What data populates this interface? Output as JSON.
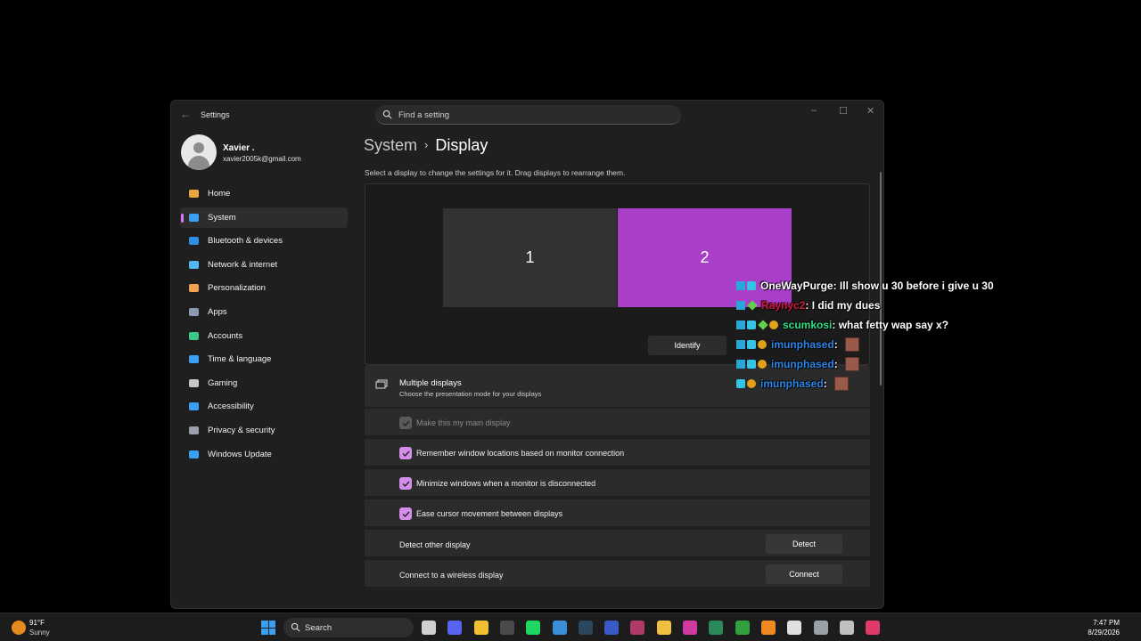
{
  "window": {
    "app_title": "Settings",
    "search_placeholder": "Find a setting",
    "controls": {
      "minimize": "–",
      "maximize": "☐",
      "close": "✕"
    },
    "back": "←"
  },
  "user": {
    "name": "Xavier .",
    "email": "xavier2005k@gmail.com"
  },
  "sidebar": {
    "items": [
      {
        "label": "Home",
        "icon": "home-icon",
        "color": "#e8a640"
      },
      {
        "label": "System",
        "icon": "system-icon",
        "color": "#3aa0f3",
        "active": true
      },
      {
        "label": "Bluetooth & devices",
        "icon": "bluetooth-icon",
        "color": "#2f8fe6"
      },
      {
        "label": "Network & internet",
        "icon": "network-icon",
        "color": "#54b6f0"
      },
      {
        "label": "Personalization",
        "icon": "brush-icon",
        "color": "#f0a050"
      },
      {
        "label": "Apps",
        "icon": "apps-icon",
        "color": "#8a9ab0"
      },
      {
        "label": "Accounts",
        "icon": "accounts-icon",
        "color": "#3cc88a"
      },
      {
        "label": "Time & language",
        "icon": "globe-icon",
        "color": "#3aa0f3"
      },
      {
        "label": "Gaming",
        "icon": "gamepad-icon",
        "color": "#c8c8c8"
      },
      {
        "label": "Accessibility",
        "icon": "accessibility-icon",
        "color": "#3aa0f3"
      },
      {
        "label": "Privacy & security",
        "icon": "shield-icon",
        "color": "#9aa0a8"
      },
      {
        "label": "Windows Update",
        "icon": "update-icon",
        "color": "#3aa0f3"
      }
    ]
  },
  "main": {
    "breadcrumb_parent": "System",
    "breadcrumb_sep": "›",
    "breadcrumb_current": "Display",
    "instruction": "Select a display to change the settings for it. Drag displays to rearrange them.",
    "monitors": [
      "1",
      "2"
    ],
    "identify_label": "Identify",
    "multiple_displays": {
      "title": "Multiple displays",
      "subtitle": "Choose the presentation mode for your displays"
    },
    "options": [
      {
        "label": "Make this my main display",
        "checked": true,
        "disabled": true
      },
      {
        "label": "Remember window locations based on monitor connection",
        "checked": true,
        "disabled": false
      },
      {
        "label": "Minimize windows when a monitor is disconnected",
        "checked": true,
        "disabled": false
      },
      {
        "label": "Ease cursor movement between displays",
        "checked": true,
        "disabled": false
      }
    ],
    "actions": [
      {
        "label": "Detect other display",
        "button": "Detect"
      },
      {
        "label": "Connect to a wireless display",
        "button": "Connect"
      }
    ]
  },
  "chat": [
    {
      "name": "OneWayPurge",
      "color": "#ffffff",
      "message": " : Ill show u 30 before i give u 30",
      "badges": [
        "prime",
        "sub"
      ]
    },
    {
      "name": "Raynyc2",
      "color": "#d01b3c",
      "message": " : I did my dues",
      "badges": [
        "prime",
        "gift"
      ]
    },
    {
      "name": "scumkosi",
      "color": "#2fe08a",
      "message": " : what fetty wap say x?",
      "badges": [
        "prime",
        "sub",
        "gift",
        "gold"
      ]
    },
    {
      "name": "imunphased",
      "color": "#2a86e8",
      "message": " :",
      "badges": [
        "prime",
        "sub",
        "gold"
      ],
      "emote": true
    },
    {
      "name": "imunphased",
      "color": "#2a86e8",
      "message": " :",
      "badges": [
        "prime",
        "sub",
        "gold"
      ],
      "emote": true
    },
    {
      "name": "imunphased",
      "color": "#2a86e8",
      "message": " :",
      "badges": [
        "sub",
        "gold"
      ],
      "emote": true
    }
  ],
  "taskbar": {
    "weather_temp": "91°F",
    "weather_condition": "Sunny",
    "search_label": "Search",
    "time": "7:47 PM",
    "date": "8/29/2026",
    "apps": [
      {
        "icon": "taskview-icon",
        "color": "#d0d0d0"
      },
      {
        "icon": "discord-icon",
        "color": "#5865f2"
      },
      {
        "icon": "chrome-icon",
        "color": "#f0c030"
      },
      {
        "icon": "obs-icon",
        "color": "#4a4a4a"
      },
      {
        "icon": "spotify-icon",
        "color": "#1ed760"
      },
      {
        "icon": "photos-icon",
        "color": "#3a8fd8"
      },
      {
        "icon": "steam-icon",
        "color": "#2a475e"
      },
      {
        "icon": "app-icon",
        "color": "#3a5ac8"
      },
      {
        "icon": "winrar-icon",
        "color": "#b03a6a"
      },
      {
        "icon": "file-explorer-icon",
        "color": "#f0c040"
      },
      {
        "icon": "app2-icon",
        "color": "#d03aa0"
      },
      {
        "icon": "app3-icon",
        "color": "#2a8a5a"
      },
      {
        "icon": "app4-icon",
        "color": "#30a040"
      },
      {
        "icon": "fl-studio-icon",
        "color": "#f08a20"
      },
      {
        "icon": "app5-icon",
        "color": "#e0e0e0"
      },
      {
        "icon": "settings-icon",
        "color": "#9aa0a8"
      },
      {
        "icon": "app6-icon",
        "color": "#c0c0c0"
      },
      {
        "icon": "app7-icon",
        "color": "#e03a6a"
      }
    ]
  }
}
